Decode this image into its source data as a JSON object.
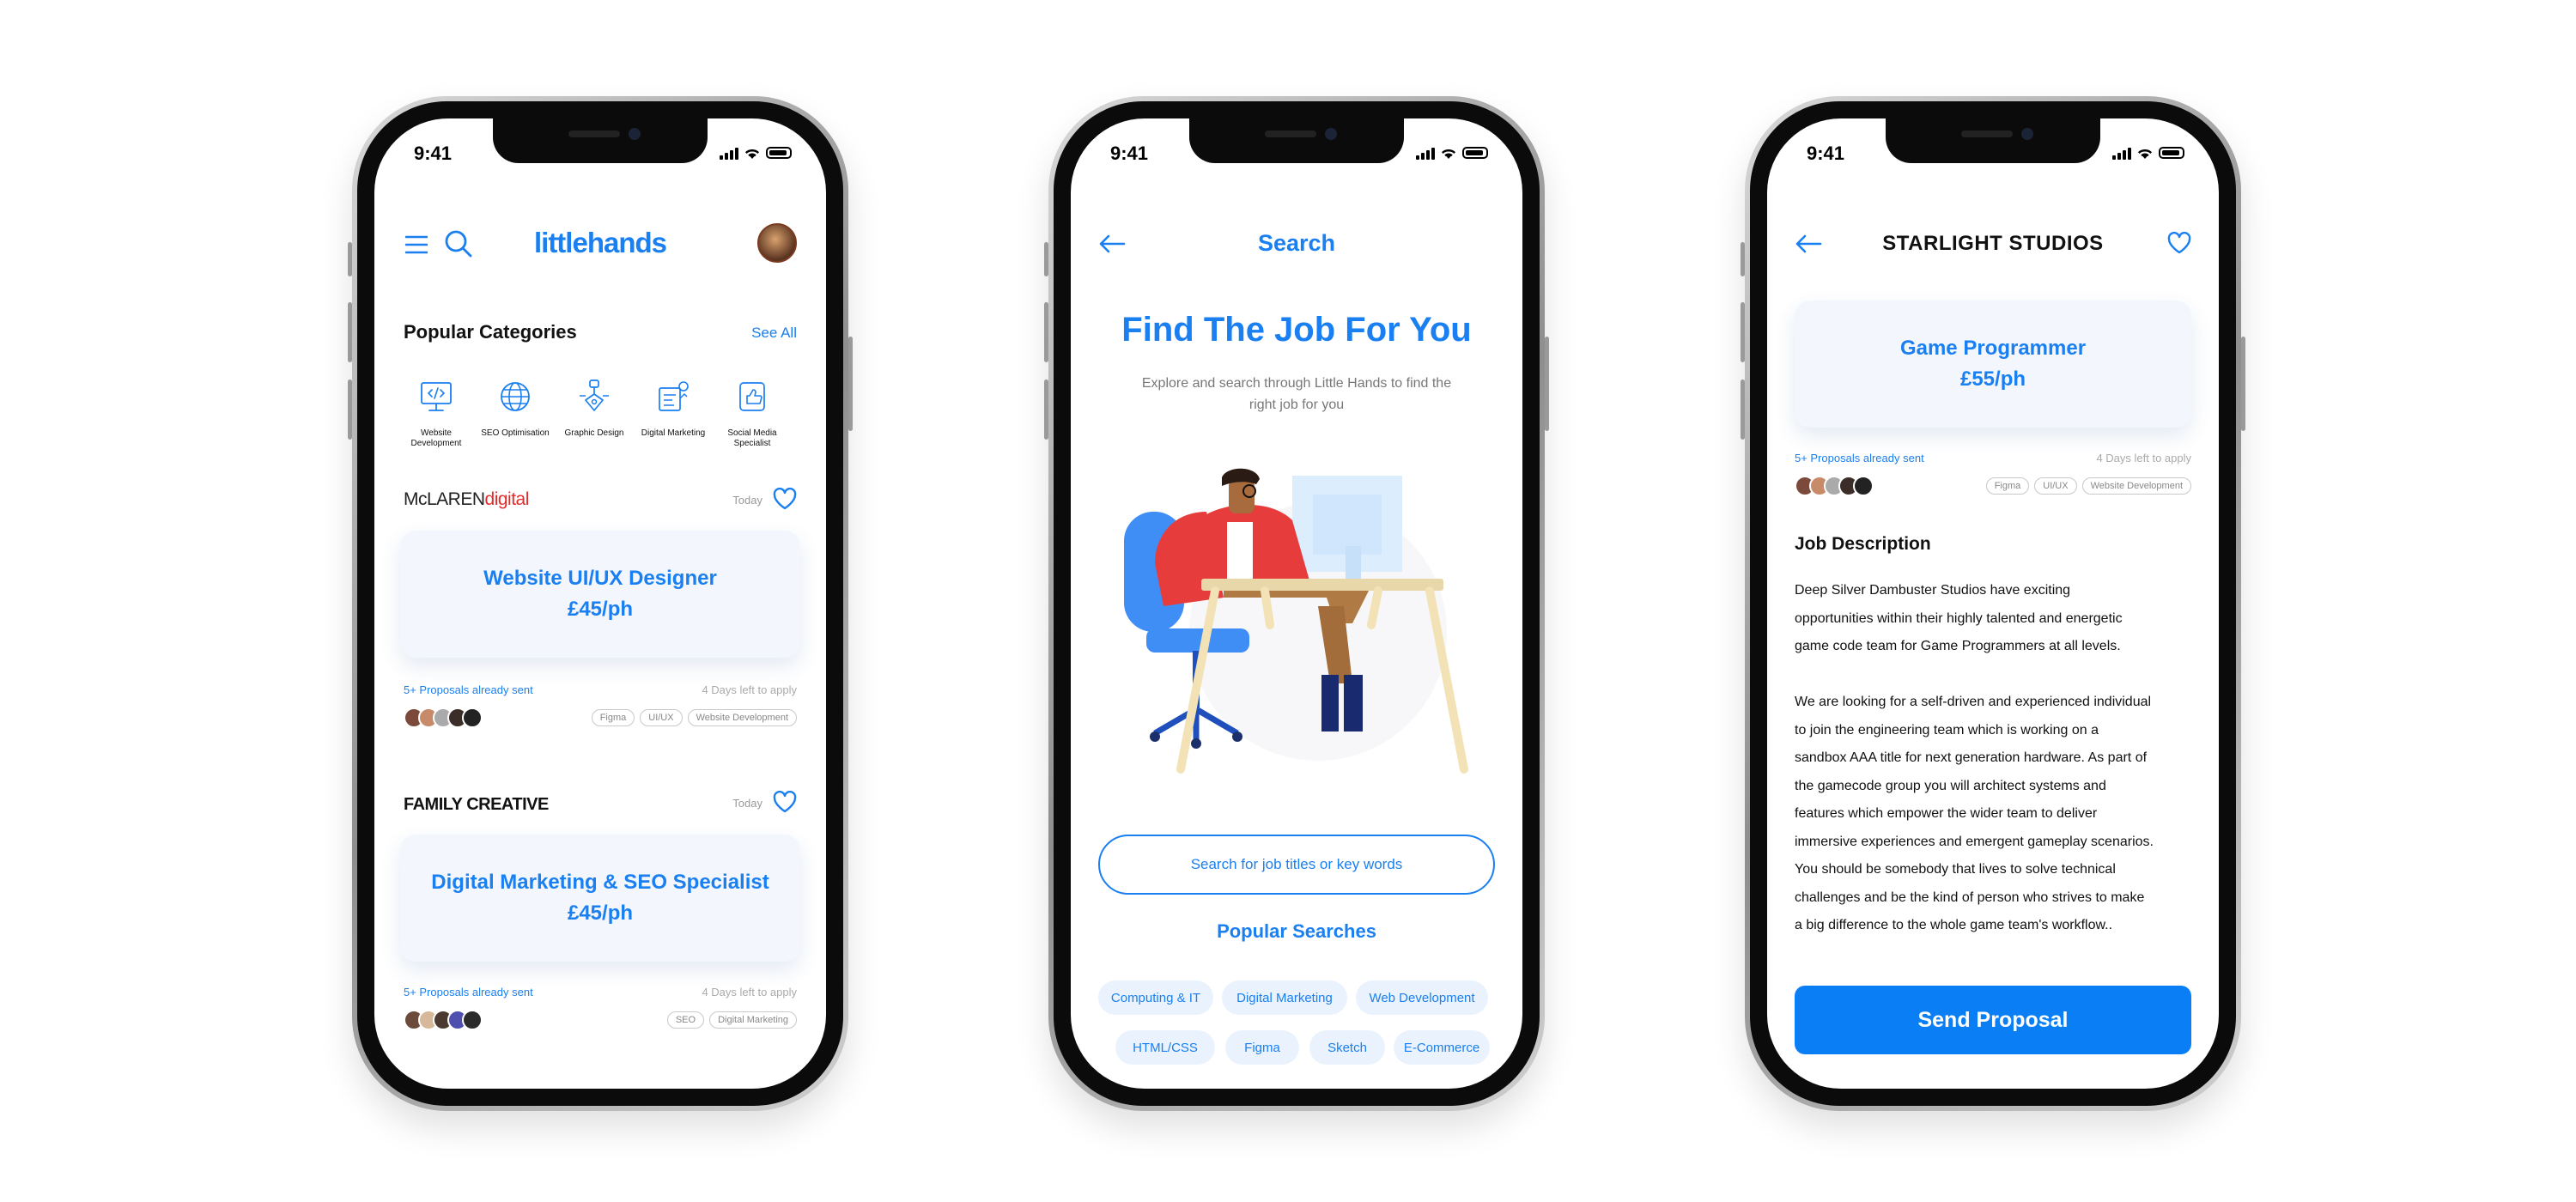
{
  "status_time": "9:41",
  "screen1": {
    "brand": "littlehands",
    "section_title": "Popular Categories",
    "see_all": "See All",
    "categories": [
      {
        "label": "Website Development",
        "icon": "monitor-code-icon"
      },
      {
        "label": "SEO Optimisation",
        "icon": "globe-icon"
      },
      {
        "label": "Graphic Design",
        "icon": "pen-tool-icon"
      },
      {
        "label": "Digital Marketing",
        "icon": "marketing-icon"
      },
      {
        "label": "Social Media Specialist",
        "icon": "thumbs-up-icon"
      }
    ],
    "jobs": [
      {
        "company_a": "McLAREN",
        "company_b": "digital",
        "posted": "Today",
        "title": "Website UI/UX Designer",
        "rate": "£45/ph",
        "proposals": "5+ Proposals already sent",
        "days_left": "4 Days left to apply",
        "tags": [
          "Figma",
          "UI/UX",
          "Website Development"
        ]
      },
      {
        "company_a": "FAMILY CREATIVE",
        "company_b": "",
        "posted": "Today",
        "title": "Digital Marketing & SEO Specialist",
        "rate": "£45/ph",
        "proposals": "5+ Proposals already sent",
        "days_left": "4 Days left to apply",
        "tags": [
          "SEO",
          "Digital Marketing"
        ]
      }
    ]
  },
  "screen2": {
    "header": "Search",
    "hero_title": "Find The Job For You",
    "hero_sub_line1": "Explore and search through Little Hands to find the",
    "hero_sub_line2": "right job for you",
    "search_placeholder": "Search for job titles or key words",
    "popular_title": "Popular Searches",
    "chips": [
      "Computing & IT",
      "Digital Marketing",
      "Web Development",
      "HTML/CSS",
      "Figma",
      "Sketch",
      "E-Commerce"
    ]
  },
  "screen3": {
    "studio": "STARLIGHT STUDIOS",
    "title": "Game Programmer",
    "rate": "£55/ph",
    "proposals": "5+ Proposals already sent",
    "days_left": "4 Days left to apply",
    "tags": [
      "Figma",
      "UI/UX",
      "Website Development"
    ],
    "desc_title": "Job Description",
    "desc_lines": [
      "Deep Silver Dambuster Studios have exciting",
      "opportunities within their highly talented and energetic",
      "game code team for Game Programmers at all levels.",
      "",
      "We are looking for a self-driven and experienced individual",
      "to join the engineering team which is working on a",
      "sandbox AAA title for next generation hardware. As part of",
      "the gamecode group you will architect systems and",
      "features which empower the wider team to deliver",
      "immersive experiences and emergent gameplay scenarios.",
      "You should be somebody that lives to solve technical",
      "challenges and be the kind of person who strives to make",
      "a big difference to the whole game team's workflow.."
    ],
    "send_label": "Send Proposal"
  },
  "colors": {
    "accent": "#1a7ff0",
    "button": "#0a7ff5",
    "mclaren_red": "#e32b2b"
  }
}
